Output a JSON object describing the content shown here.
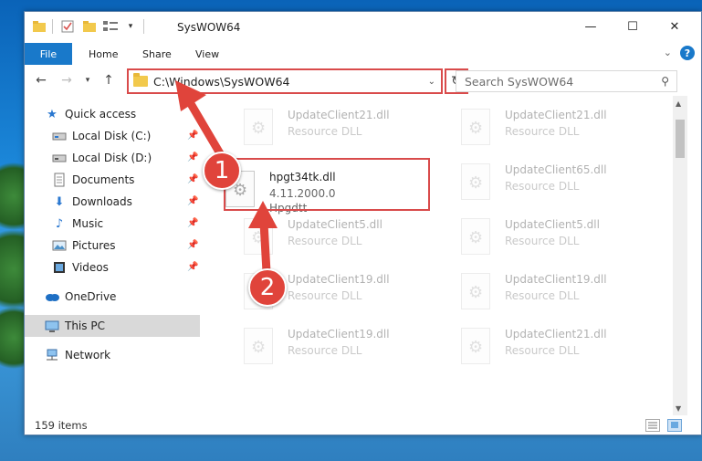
{
  "window": {
    "title": "SysWOW64",
    "minimize_glyph": "—",
    "maximize_glyph": "☐",
    "close_glyph": "✕"
  },
  "ribbon": {
    "tabs": [
      "File",
      "Home",
      "Share",
      "View"
    ],
    "help": "?"
  },
  "address": {
    "path": "C:\\Windows\\SysWOW64",
    "search_placeholder": "Search SysWOW64"
  },
  "sidebar": {
    "items": [
      {
        "label": "Quick access",
        "icon": "star-icon",
        "pinned": false
      },
      {
        "label": "Local Disk (C:)",
        "icon": "drive-icon",
        "pinned": true
      },
      {
        "label": "Local Disk (D:)",
        "icon": "drive-icon",
        "pinned": true
      },
      {
        "label": "Documents",
        "icon": "documents-icon",
        "pinned": true
      },
      {
        "label": "Downloads",
        "icon": "download-icon",
        "pinned": true
      },
      {
        "label": "Music",
        "icon": "music-icon",
        "pinned": true
      },
      {
        "label": "Pictures",
        "icon": "pictures-icon",
        "pinned": true
      },
      {
        "label": "Videos",
        "icon": "videos-icon",
        "pinned": true
      },
      {
        "label": "OneDrive",
        "icon": "cloud-icon",
        "pinned": false
      },
      {
        "label": "This PC",
        "icon": "pc-icon",
        "pinned": false,
        "selected": true
      },
      {
        "label": "Network",
        "icon": "network-icon",
        "pinned": false
      }
    ]
  },
  "files": [
    {
      "name": "UpdateClient21.dll",
      "type": "Resource DLL",
      "faded": true
    },
    {
      "name": "UpdateClient21.dll",
      "type": "Resource DLL",
      "faded": true
    },
    {
      "name": "hpgt34tk.dll",
      "version": "4.11.2000.0",
      "type": "Hpgdtt",
      "faded": false
    },
    {
      "name": "UpdateClient65.dll",
      "type": "Resource DLL",
      "faded": true
    },
    {
      "name": "UpdateClient5.dll",
      "type": "Resource DLL",
      "faded": true
    },
    {
      "name": "UpdateClient5.dll",
      "type": "Resource DLL",
      "faded": true
    },
    {
      "name": "UpdateClient19.dll",
      "type": "Resource DLL",
      "faded": true
    },
    {
      "name": "UpdateClient19.dll",
      "type": "Resource DLL",
      "faded": true
    },
    {
      "name": "UpdateClient19.dll",
      "type": "Resource DLL",
      "faded": true
    },
    {
      "name": "UpdateClient21.dll",
      "type": "Resource DLL",
      "faded": true
    }
  ],
  "status": {
    "item_count": "159 items"
  },
  "annotations": {
    "step1": "1",
    "step2": "2",
    "color": "#e0443b"
  }
}
